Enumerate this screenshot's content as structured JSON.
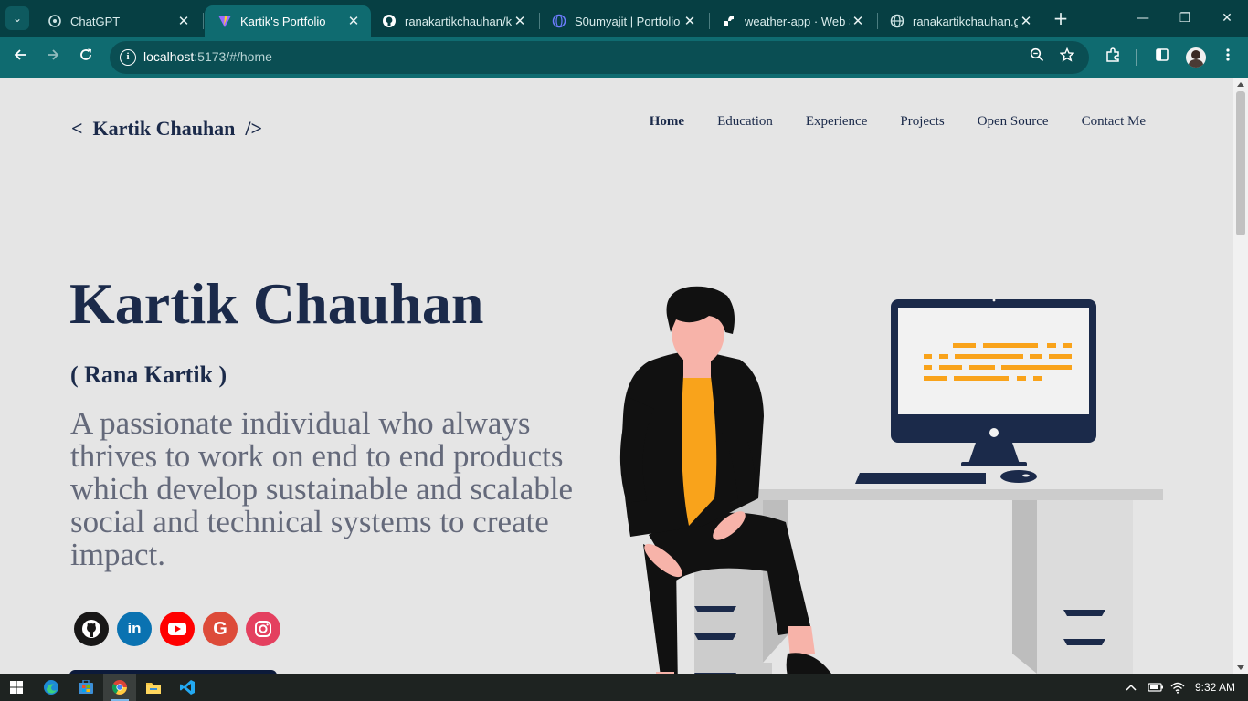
{
  "browser": {
    "tabs": [
      {
        "title": "ChatGPT",
        "favicon": "chatgpt-icon",
        "active": false
      },
      {
        "title": "Kartik's Portfolio",
        "favicon": "vite-icon",
        "active": true
      },
      {
        "title": "ranakartikchauhan/ka",
        "favicon": "github-icon",
        "active": false
      },
      {
        "title": "S0umyajit | Portfolio",
        "favicon": "globe-icon",
        "active": false
      },
      {
        "title": "weather-app · Web S",
        "favicon": "render-icon",
        "active": false
      },
      {
        "title": "ranakartikchauhan.git",
        "favicon": "globe-icon",
        "active": false
      }
    ],
    "close_glyph": "✕",
    "new_tab_glyph": "+",
    "window_controls": {
      "minimize": "—",
      "restore": "❐",
      "close": "✕"
    },
    "address": {
      "host": "localhost",
      "path": ":5173/#/home"
    }
  },
  "site": {
    "logo": "<  Kartik Chauhan  />",
    "nav": [
      "Home",
      "Education",
      "Experience",
      "Projects",
      "Open Source",
      "Contact Me"
    ],
    "current_nav": "Home",
    "hero": {
      "name": "Kartik Chauhan",
      "subtitle": "( Rana Kartik )",
      "bio": "A passionate individual who always thrives to work on end to end products which develop sustainable and scalable social and technical systems to create impact."
    },
    "socials": [
      {
        "name": "github",
        "icon": "github-icon",
        "color": "#181717",
        "glyph": "◉"
      },
      {
        "name": "linkedin",
        "icon": "linkedin-icon",
        "color": "#0a72b1",
        "glyph": "in"
      },
      {
        "name": "youtube",
        "icon": "youtube-icon",
        "color": "#ff0000",
        "glyph": "▶"
      },
      {
        "name": "google",
        "icon": "google-icon",
        "color": "#dd4b39",
        "glyph": "G"
      },
      {
        "name": "instagram",
        "icon": "instagram-icon",
        "color": "#e4405f",
        "glyph": "◎"
      }
    ],
    "colors": {
      "navy": "#1b2a4a",
      "accent": "#f9a31b",
      "skin": "#f7b3a9",
      "desk": "#cccccc"
    }
  },
  "taskbar": {
    "time": "9:32 AM",
    "apps": [
      "windows-start-icon",
      "edge-icon",
      "store-icon",
      "chrome-icon",
      "file-explorer-icon",
      "vscode-icon"
    ]
  }
}
